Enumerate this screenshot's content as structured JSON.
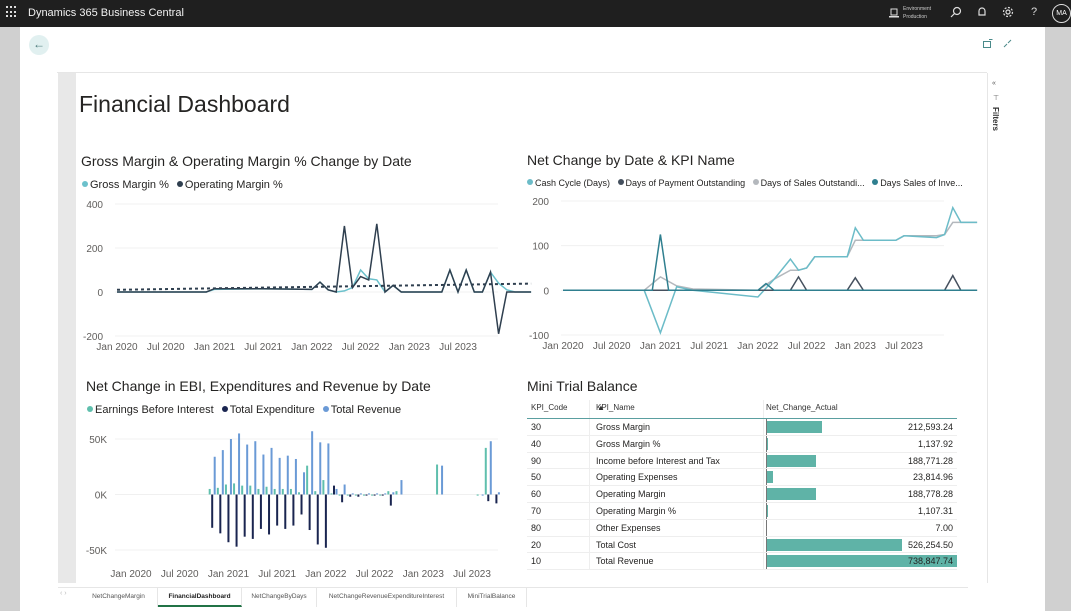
{
  "topbar": {
    "app_title": "Dynamics 365 Business Central",
    "environment_label": "Environment",
    "environment_value": "Production",
    "icons": [
      "waffle-icon",
      "environment-icon",
      "search-icon",
      "bell-icon",
      "gear-icon",
      "help-icon"
    ],
    "help_glyph": "?",
    "avatar_initials": "MA"
  },
  "page": {
    "back_glyph": "←",
    "dashboard_title": "Financial Dashboard",
    "filters_label": "Filters",
    "filters_collapse_glyph": "«",
    "filters_icon_glyph": "⊤"
  },
  "colors": {
    "gross_margin": "#6cc1cc",
    "operating_margin": "#2f3f4f",
    "cash_cycle": "#6cbcc8",
    "days_payment": "#45505e",
    "days_sales_outstanding": "#b4b8bd",
    "days_sales_inventory": "#2f7f8f",
    "ebi": "#5fbfad",
    "total_expenditure": "#1a2550",
    "total_revenue": "#6a9ad6",
    "table_bar": "#5fb3a7"
  },
  "chart_data": [
    {
      "type": "line",
      "title": "Gross Margin & Operating Margin % Change by Date",
      "legend_position": "top-left",
      "xlabel": "",
      "ylabel": "",
      "ylim": [
        -200,
        400
      ],
      "yticks": [
        "400",
        "200",
        "0",
        "-200"
      ],
      "ytick_values": [
        400,
        200,
        0,
        -200
      ],
      "xticks": [
        "Jan 2020",
        "Jul 2020",
        "Jan 2021",
        "Jul 2021",
        "Jan 2022",
        "Jul 2022",
        "Jan 2023",
        "Jul 2023"
      ],
      "x_months_range": [
        0,
        47
      ],
      "series": [
        {
          "name": "Gross Margin %",
          "key": "gross_margin",
          "points": [
            [
              0,
              0
            ],
            [
              6,
              0
            ],
            [
              11,
              0
            ],
            [
              12,
              12
            ],
            [
              18,
              15
            ],
            [
              24,
              12
            ],
            [
              25,
              45
            ],
            [
              26,
              10
            ],
            [
              27,
              0
            ],
            [
              28,
              5
            ],
            [
              29,
              20
            ],
            [
              30,
              100
            ],
            [
              31,
              60
            ],
            [
              32,
              55
            ],
            [
              33,
              0
            ],
            [
              34,
              30
            ],
            [
              35,
              0
            ],
            [
              40,
              0
            ],
            [
              41,
              100
            ],
            [
              42,
              0
            ],
            [
              43,
              100
            ],
            [
              44,
              0
            ],
            [
              45,
              0
            ],
            [
              46,
              90
            ],
            [
              47,
              40
            ],
            [
              48,
              10
            ],
            [
              49,
              0
            ],
            [
              51,
              0
            ]
          ]
        },
        {
          "name": "Operating Margin %",
          "key": "operating_margin",
          "points": [
            [
              0,
              0
            ],
            [
              6,
              0
            ],
            [
              11,
              0
            ],
            [
              12,
              15
            ],
            [
              18,
              15
            ],
            [
              24,
              12
            ],
            [
              25,
              45
            ],
            [
              26,
              10
            ],
            [
              27,
              0
            ],
            [
              28,
              300
            ],
            [
              29,
              20
            ],
            [
              30,
              70
            ],
            [
              31,
              55
            ],
            [
              32,
              310
            ],
            [
              33,
              0
            ],
            [
              34,
              30
            ],
            [
              35,
              0
            ],
            [
              40,
              0
            ],
            [
              41,
              100
            ],
            [
              42,
              0
            ],
            [
              43,
              100
            ],
            [
              44,
              0
            ],
            [
              45,
              0
            ],
            [
              46,
              90
            ],
            [
              47,
              -190
            ],
            [
              48,
              0
            ],
            [
              51,
              0
            ]
          ]
        },
        {
          "name": "Trend",
          "key": "operating_margin",
          "dashed": true,
          "points": [
            [
              0,
              10
            ],
            [
              51,
              38
            ]
          ]
        }
      ]
    },
    {
      "type": "line",
      "title": "Net Change by Date & KPI Name",
      "legend_position": "top-left",
      "xlabel": "",
      "ylabel": "",
      "ylim": [
        -100,
        200
      ],
      "yticks": [
        "200",
        "100",
        "0",
        "-100"
      ],
      "ytick_values": [
        200,
        100,
        0,
        -100
      ],
      "xticks": [
        "Jan 2020",
        "Jul 2020",
        "Jan 2021",
        "Jul 2021",
        "Jan 2022",
        "Jul 2022",
        "Jan 2023",
        "Jul 2023"
      ],
      "series": [
        {
          "name": "Cash Cycle (Days)",
          "key": "cash_cycle",
          "points": [
            [
              0,
              0
            ],
            [
              10,
              0
            ],
            [
              12,
              -95
            ],
            [
              14,
              8
            ],
            [
              16,
              0
            ],
            [
              24,
              -15
            ],
            [
              26,
              25
            ],
            [
              28,
              70
            ],
            [
              29,
              45
            ],
            [
              30,
              50
            ],
            [
              31,
              75
            ],
            [
              35,
              75
            ],
            [
              36,
              140
            ],
            [
              37,
              112
            ],
            [
              41,
              112
            ],
            [
              42,
              122
            ],
            [
              46,
              118
            ],
            [
              47,
              125
            ],
            [
              48,
              185
            ],
            [
              49,
              152
            ],
            [
              51,
              152
            ]
          ]
        },
        {
          "name": "Days of Payment Outstanding",
          "key": "days_payment",
          "points": [
            [
              0,
              0
            ],
            [
              28,
              0
            ],
            [
              29,
              30
            ],
            [
              30,
              0
            ],
            [
              35,
              0
            ],
            [
              36,
              28
            ],
            [
              37,
              0
            ],
            [
              47,
              0
            ],
            [
              48,
              33
            ],
            [
              49,
              0
            ],
            [
              51,
              0
            ]
          ]
        },
        {
          "name": "Days of Sales Outstandi...",
          "key": "days_sales_outstanding",
          "points": [
            [
              0,
              0
            ],
            [
              10,
              0
            ],
            [
              12,
              30
            ],
            [
              14,
              10
            ],
            [
              16,
              3
            ],
            [
              24,
              0
            ],
            [
              26,
              25
            ],
            [
              28,
              45
            ],
            [
              29,
              45
            ],
            [
              30,
              50
            ],
            [
              31,
              75
            ],
            [
              35,
              75
            ],
            [
              36,
              112
            ],
            [
              41,
              112
            ],
            [
              42,
              122
            ],
            [
              46,
              122
            ],
            [
              47,
              125
            ],
            [
              48,
              152
            ],
            [
              51,
              152
            ]
          ]
        },
        {
          "name": "Days Sales of Inve...",
          "key": "days_sales_inventory",
          "points": [
            [
              0,
              0
            ],
            [
              11,
              0
            ],
            [
              12,
              125
            ],
            [
              13,
              0
            ],
            [
              24,
              0
            ],
            [
              25,
              15
            ],
            [
              26,
              0
            ],
            [
              51,
              0
            ]
          ]
        }
      ]
    },
    {
      "type": "bar",
      "title": "Net Change in EBI, Expenditures and Revenue by Date",
      "legend_position": "top-left",
      "xlabel": "",
      "ylabel": "",
      "ylim": [
        -55000,
        55000
      ],
      "yticks": [
        "50K",
        "0K",
        "-50K"
      ],
      "ytick_values": [
        50000,
        0,
        -50000
      ],
      "xticks": [
        "Jan 2020",
        "Jul 2020",
        "Jan 2021",
        "Jul 2021",
        "Jan 2022",
        "Jul 2022",
        "Jan 2023",
        "Jul 2023"
      ],
      "months": [
        12,
        13,
        14,
        15,
        16,
        17,
        18,
        19,
        20,
        21,
        22,
        23,
        24,
        25,
        26,
        27,
        28,
        29,
        30,
        31,
        32,
        33,
        34,
        35,
        40,
        45,
        46,
        47
      ],
      "series": [
        {
          "name": "Earnings Before Interest",
          "key": "ebi",
          "values": [
            5000,
            6000,
            9000,
            10000,
            8000,
            8000,
            5000,
            7000,
            5000,
            5000,
            5000,
            2000,
            26000,
            3000,
            13000,
            1000,
            -1000,
            -1000,
            -1000,
            -1000,
            -1000,
            -1000,
            3000,
            3000,
            27000,
            -1000,
            42000,
            0
          ]
        },
        {
          "name": "Total Expenditure",
          "key": "total_expenditure",
          "values": [
            -30000,
            -35000,
            -43000,
            -47000,
            -38000,
            -40000,
            -31000,
            -36000,
            -28000,
            -31000,
            -28000,
            -18000,
            -32000,
            -45000,
            -48000,
            8000,
            -7000,
            -2000,
            -2000,
            -1000,
            -1000,
            -1000,
            -10000,
            0,
            0,
            0,
            -6000,
            -8000
          ]
        },
        {
          "name": "Total Revenue",
          "key": "total_revenue",
          "values": [
            34000,
            40000,
            50000,
            55000,
            45000,
            48000,
            36000,
            42000,
            33000,
            35000,
            32000,
            20000,
            57000,
            47000,
            46000,
            5000,
            9000,
            1000,
            1000,
            1000,
            1000,
            1000,
            2000,
            13000,
            26000,
            -1000,
            48000,
            2000
          ]
        }
      ]
    },
    {
      "type": "table",
      "title": "Mini Trial Balance",
      "columns": [
        "KPI_Code",
        "KPI_Name",
        "Net_Change_Actual"
      ],
      "sort_column": "KPI_Name",
      "rows": [
        {
          "code": "30",
          "name": "Gross Margin",
          "value": "212,593.24",
          "num": 212593.24
        },
        {
          "code": "40",
          "name": "Gross Margin %",
          "value": "1,137.92",
          "num": 1137.92
        },
        {
          "code": "90",
          "name": "Income before Interest and Tax",
          "value": "188,771.28",
          "num": 188771.28
        },
        {
          "code": "50",
          "name": "Operating Expenses",
          "value": "23,814.96",
          "num": 23814.96
        },
        {
          "code": "60",
          "name": "Operating Margin",
          "value": "188,778.28",
          "num": 188778.28
        },
        {
          "code": "70",
          "name": "Operating Margin %",
          "value": "1,107.31",
          "num": 1107.31
        },
        {
          "code": "80",
          "name": "Other Expenses",
          "value": "7.00",
          "num": 7.0
        },
        {
          "code": "20",
          "name": "Total Cost",
          "value": "526,254.50",
          "num": 526254.5
        },
        {
          "code": "10",
          "name": "Total Revenue",
          "value": "738,847.74",
          "num": 738847.74
        }
      ]
    }
  ],
  "tabs": [
    {
      "label": "NetChangeMargin",
      "active": false
    },
    {
      "label": "FinancialDashboard",
      "active": true
    },
    {
      "label": "NetChangeByDays",
      "active": false
    },
    {
      "label": "NetChangeRevenueExpenditureInterest",
      "active": false
    },
    {
      "label": "MiniTrialBalance",
      "active": false
    }
  ],
  "tab_nav_glyphs": "‹ ›"
}
